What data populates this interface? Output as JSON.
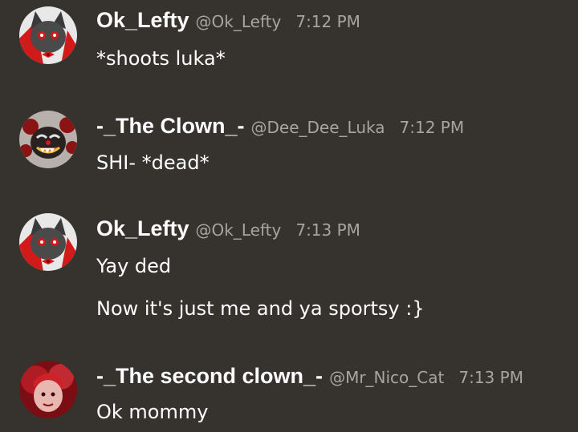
{
  "colors": {
    "background": "#36332f",
    "username": "#ffffff",
    "meta": "#a8a49f",
    "text": "#ffffff"
  },
  "messages": [
    {
      "avatar_icon": "cat-avatar-icon",
      "username": "Ok_Lefty",
      "handle": "@Ok_Lefty",
      "timestamp": "7:12 PM",
      "lines": [
        "*shoots luka*"
      ]
    },
    {
      "avatar_icon": "clown-avatar-icon",
      "username": "-_The Clown_-",
      "handle": "@Dee_Dee_Luka",
      "timestamp": "7:12 PM",
      "lines": [
        "SHI- *dead*"
      ]
    },
    {
      "avatar_icon": "cat-avatar-icon",
      "username": "Ok_Lefty",
      "handle": "@Ok_Lefty",
      "timestamp": "7:13 PM",
      "lines": [
        "Yay ded",
        "Now it's just me and ya sportsy :}"
      ]
    },
    {
      "avatar_icon": "red-character-avatar-icon",
      "username": "-_The second clown_-",
      "handle": "@Mr_Nico_Cat",
      "timestamp": "7:13 PM",
      "lines": [
        "Ok mommy"
      ]
    }
  ]
}
